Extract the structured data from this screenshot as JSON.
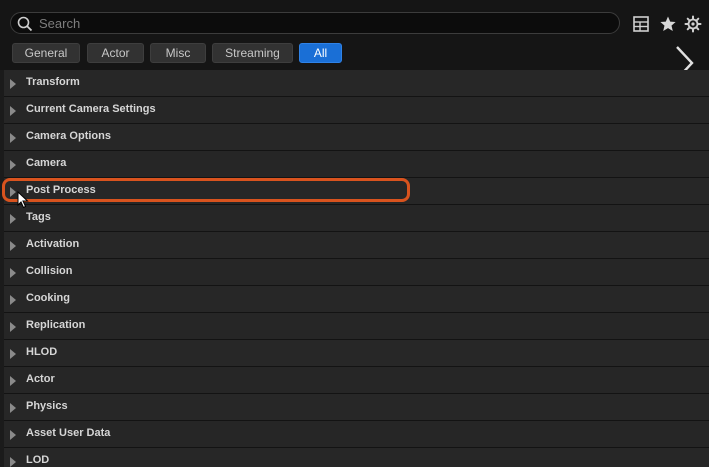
{
  "search": {
    "placeholder": "Search"
  },
  "toolbar": {
    "icons": [
      "table-view-icon",
      "star-icon",
      "settings-gear-icon"
    ]
  },
  "tabs": [
    {
      "label": "General",
      "active": false
    },
    {
      "label": "Actor",
      "active": false
    },
    {
      "label": "Misc",
      "active": false
    },
    {
      "label": "Streaming",
      "active": false
    },
    {
      "label": "All",
      "active": true
    }
  ],
  "categories": [
    {
      "label": "Transform"
    },
    {
      "label": "Current Camera Settings"
    },
    {
      "label": "Camera Options"
    },
    {
      "label": "Camera"
    },
    {
      "label": "Post Process"
    },
    {
      "label": "Tags"
    },
    {
      "label": "Activation"
    },
    {
      "label": "Collision"
    },
    {
      "label": "Cooking"
    },
    {
      "label": "Replication"
    },
    {
      "label": "HLOD"
    },
    {
      "label": "Actor"
    },
    {
      "label": "Physics"
    },
    {
      "label": "Asset User Data"
    },
    {
      "label": "LOD"
    }
  ],
  "annotation": {
    "highlighted_item": "Post Process",
    "color": "#d9531e"
  },
  "colors": {
    "accent": "#1a6fd6",
    "background": "#1b1b1b"
  }
}
